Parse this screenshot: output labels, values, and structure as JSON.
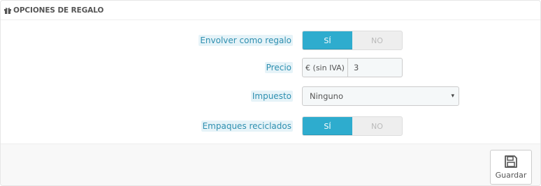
{
  "panel": {
    "title": "OPCIONES DE REGALO",
    "title_icon": "gift-icon"
  },
  "fields": {
    "wrap": {
      "label": "Envolver como regalo",
      "on_label": "SÍ",
      "off_label": "NO",
      "selected": "on"
    },
    "price": {
      "label": "Precio",
      "addon": "€ (sin IVA)",
      "value": "3"
    },
    "tax": {
      "label": "Impuesto",
      "selected": "Ninguno",
      "caret": "▾"
    },
    "recycled": {
      "label": "Empaques reciclados",
      "on_label": "SÍ",
      "off_label": "NO",
      "selected": "on"
    }
  },
  "footer": {
    "save_label": "Guardar",
    "save_icon": "save-icon"
  },
  "colors": {
    "accent": "#2eacce",
    "label_highlight": "#e6f3f8",
    "label_text": "#2e8fb0"
  }
}
